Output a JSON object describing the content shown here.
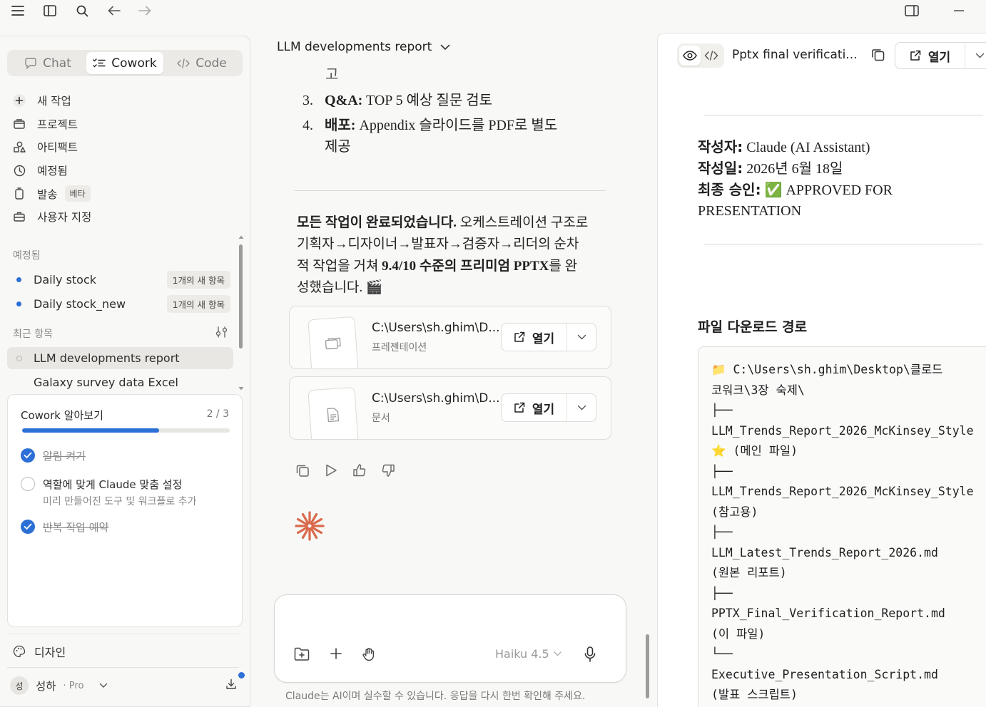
{
  "topbar": {
    "icons": [
      "menu-icon",
      "sidebar-icon",
      "search-icon",
      "back-arrow-icon",
      "forward-arrow-icon",
      "panel-icon",
      "minimize-icon"
    ]
  },
  "sidebar": {
    "mode_tabs": [
      {
        "label": "Chat",
        "icon": "chat-bubble-icon",
        "active": false
      },
      {
        "label": "Cowork",
        "icon": "checklist-icon",
        "active": true
      },
      {
        "label": "Code",
        "icon": "code-icon",
        "active": false
      }
    ],
    "nav": [
      {
        "label": "새 작업",
        "icon": "plus-icon"
      },
      {
        "label": "프로젝트",
        "icon": "folder-icon"
      },
      {
        "label": "아티팩트",
        "icon": "shapes-icon"
      },
      {
        "label": "예정됨",
        "icon": "clock-icon"
      },
      {
        "label": "발송",
        "icon": "phone-icon",
        "badge": "베타"
      },
      {
        "label": "사용자 지정",
        "icon": "briefcase-icon"
      }
    ],
    "scheduled_label": "예정됨",
    "scheduled": [
      {
        "label": "Daily stock",
        "badge": "1개의 새 항목"
      },
      {
        "label": "Daily stock_new",
        "badge": "1개의 새 항목"
      }
    ],
    "recent_label": "최근 항목",
    "recent": [
      {
        "label": "LLM developments report",
        "active": true
      },
      {
        "label": "Galaxy survey data Excel",
        "active": false
      }
    ],
    "onboarding": {
      "title": "Cowork 알아보기",
      "count": "2 / 3",
      "progress": 0.66,
      "tasks": [
        {
          "label": "알림 켜기",
          "done": true
        },
        {
          "label": "역할에 맞게 Claude 맞춤 설정",
          "sub": "미리 만들어진 도구 및 워크플로 추가",
          "done": false
        },
        {
          "label": "반복 작업 예약",
          "done": true
        }
      ]
    },
    "design_label": "디자인",
    "user": {
      "avatar": "성",
      "name": "성하",
      "plan": "· Pro"
    }
  },
  "chat": {
    "title": "LLM developments report",
    "cut_line": "고",
    "list": [
      {
        "num": "3.",
        "bold": "Q&A:",
        "text": " TOP 5 예상 질문 검토"
      },
      {
        "num": "4.",
        "bold": "배포:",
        "text": " Appendix 슬라이드를 PDF로 별도",
        "text2": "제공"
      }
    ],
    "summary": {
      "bold1": "모든 작업이 완료되었습니다.",
      "text1": " 오케스트레이션 구조로 기획자→디자이너→발표자→검증자→리더의 순차적 작업을 거쳐 ",
      "bold2": "9.4/10 수준의 프리미엄 PPTX",
      "text2": "를 완성했습니다. 🎬"
    },
    "files": [
      {
        "path": "C:\\Users\\sh.ghim\\D...",
        "type": "프레젠테이션",
        "open_label": "열기",
        "icon": "slides-icon"
      },
      {
        "path": "C:\\Users\\sh.ghim\\D...",
        "type": "문서",
        "open_label": "열기",
        "icon": "document-icon"
      }
    ],
    "composer": {
      "placeholder": "",
      "model": "Haiku 4.5"
    },
    "disclaimer": "Claude는 AI이며 실수할 수 있습니다. 응답을 다시 한번 확인해 주세요."
  },
  "preview": {
    "title": "Pptx final verificati...",
    "open_label": "열기",
    "author_label": "작성자:",
    "author": " Claude (AI Assistant)",
    "date_label": "작성일:",
    "date": " 2026년 6월 18일",
    "approval_label": "최종 승인:",
    "approval": " ✅ APPROVED FOR",
    "approval2": "PRESENTATION",
    "download_heading": "파일 다운로드 경로",
    "code_lines": [
      "📁 C:\\Users\\sh.ghim\\Desktop\\클로드",
      "코워크\\3장 숙제\\",
      "├──",
      "LLM_Trends_Report_2026_McKinsey_Style",
      "⭐ (메인 파일)",
      "├──",
      "LLM_Trends_Report_2026_McKinsey_Style",
      "(참고용)",
      "├──",
      "LLM_Latest_Trends_Report_2026.md",
      "(원본 리포트)",
      "├──",
      "PPTX_Final_Verification_Report.md",
      "(이 파일)",
      "└──",
      "Executive_Presentation_Script.md",
      "(발표 스크립트)"
    ]
  },
  "colors": {
    "accent": "#2c6fd6",
    "spark": "#d9694a"
  }
}
